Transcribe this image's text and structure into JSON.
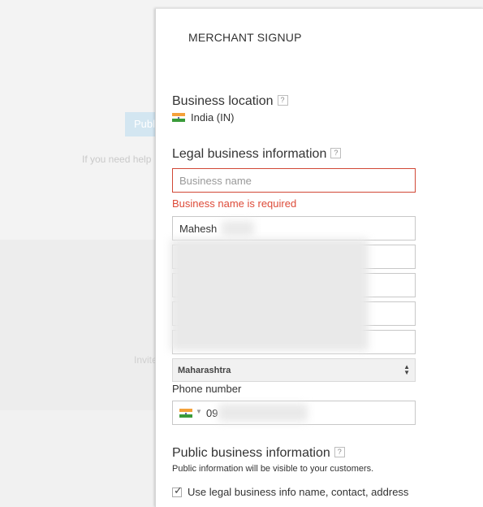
{
  "background": {
    "button_label": "Publish",
    "help_text": "If you need help",
    "invite_text": "Invite"
  },
  "dialog": {
    "title": "MERCHANT SIGNUP",
    "business_location": {
      "heading": "Business location",
      "help": "?",
      "country": "India (IN)"
    },
    "legal_info": {
      "heading": "Legal business information",
      "help": "?",
      "business_name_placeholder": "Business name",
      "business_name_value": "",
      "error": "Business name is required",
      "contact_name": "Mahesh",
      "state": "Maharashtra",
      "phone_label": "Phone number",
      "phone_prefix": "09"
    },
    "public_info": {
      "heading": "Public business information",
      "help": "?",
      "description": "Public information will be visible to your customers.",
      "checkbox_label": "Use legal business info name, contact, address",
      "checkbox_checked": true
    }
  },
  "colors": {
    "error": "#dd4b39",
    "flag_saffron": "#f4a13a",
    "flag_green": "#3a9b3a"
  },
  "icons": [
    "help-icon",
    "india-flag-icon",
    "dropdown-arrows-icon",
    "check-icon"
  ]
}
